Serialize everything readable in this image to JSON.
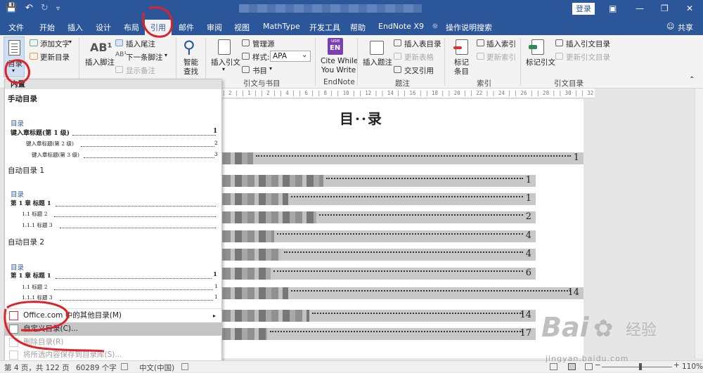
{
  "titlebar": {
    "login": "登录"
  },
  "tabs": [
    "文件",
    "开始",
    "插入",
    "设计",
    "布局",
    "引用",
    "邮件",
    "审阅",
    "视图",
    "MathType",
    "开发工具",
    "帮助",
    "EndNote X9",
    "操作说明搜索",
    "共享"
  ],
  "ribbon": {
    "toc": {
      "label": "目录",
      "add_text": "添加文字",
      "update": "更新目录"
    },
    "footnote": {
      "insert": "插入脚注",
      "insert_endnote": "插入尾注",
      "next": "下一条脚注",
      "show": "显示备注"
    },
    "search": {
      "label1": "智能",
      "label2": "查找"
    },
    "citations": {
      "insert": "插入引文",
      "manage": "管理源",
      "style_label": "样式:",
      "style_value": "APA",
      "bibliography": "书目",
      "group": "引文与书目"
    },
    "endnote": {
      "badge1": "use",
      "badge2": "EN",
      "label1": "Cite While",
      "label2": "You Write",
      "group": "EndNote"
    },
    "captions": {
      "insert": "插入题注",
      "table_of_figures": "插入表目录",
      "update_table": "更新表格",
      "cross_ref": "交叉引用",
      "group": "题注"
    },
    "index": {
      "mark": "标记",
      "entry": "条目",
      "insert": "插入索引",
      "update": "更新索引",
      "group": "索引"
    },
    "authorities": {
      "mark": "标记引文",
      "insert": "插入引文目录",
      "update": "更新引文目录",
      "group": "引文目录"
    }
  },
  "ruler": "| 2 | | 1 | | 2 | | 4 | | 6 | | 8 | | 10 | | 12 | | 14 | | 16 | | 18 | | 20 | | 22 | | 24 | | 26 | | 28 | | 30 | | 32 | | 34 | | 36 | | 38 | | 39 | | 41 | | 42 |",
  "document": {
    "title": "目··录",
    "entries": [
      {
        "page": "1"
      },
      {
        "page": "1"
      },
      {
        "page": "1"
      },
      {
        "page": "2"
      },
      {
        "page": "4"
      },
      {
        "page": "4"
      },
      {
        "page": "6"
      },
      {
        "page": "14"
      },
      {
        "page": "14"
      },
      {
        "page": "17"
      }
    ]
  },
  "menu": {
    "header": "内置",
    "manual": "手动目录",
    "toc_label": "目录",
    "manual_h1": "键入章标题(第 1 级)",
    "manual_h2": "键入章标题(第 2 级)",
    "manual_h3": "键入章标题(第 3 级)",
    "auto1": "自动目录 1",
    "auto2": "自动目录 2",
    "auto_ch": "第 1 章 标题 1",
    "auto_11": "1.1 标题 2",
    "auto_111": "1.1.1 标题 3",
    "page_1": "1",
    "page_2": "2",
    "page_3": "3",
    "office": "Office.com 中的其他目录(M)",
    "custom": "自定义目录(C)...",
    "delete": "删除目录(R)",
    "save": "将所选内容保存到目录库(S)..."
  },
  "status": {
    "page": "第 4 页，共 122 页",
    "words": "60289 个字",
    "lang": "中文(中国)",
    "zoom": "110%",
    "zoom_fraction": 0.55
  },
  "watermark": {
    "brand": "Bai",
    "cn": "经验",
    "url": "jingyan.baidu.com"
  },
  "colors": {
    "brand": "#2b579a",
    "annotation": "#e0202a"
  }
}
